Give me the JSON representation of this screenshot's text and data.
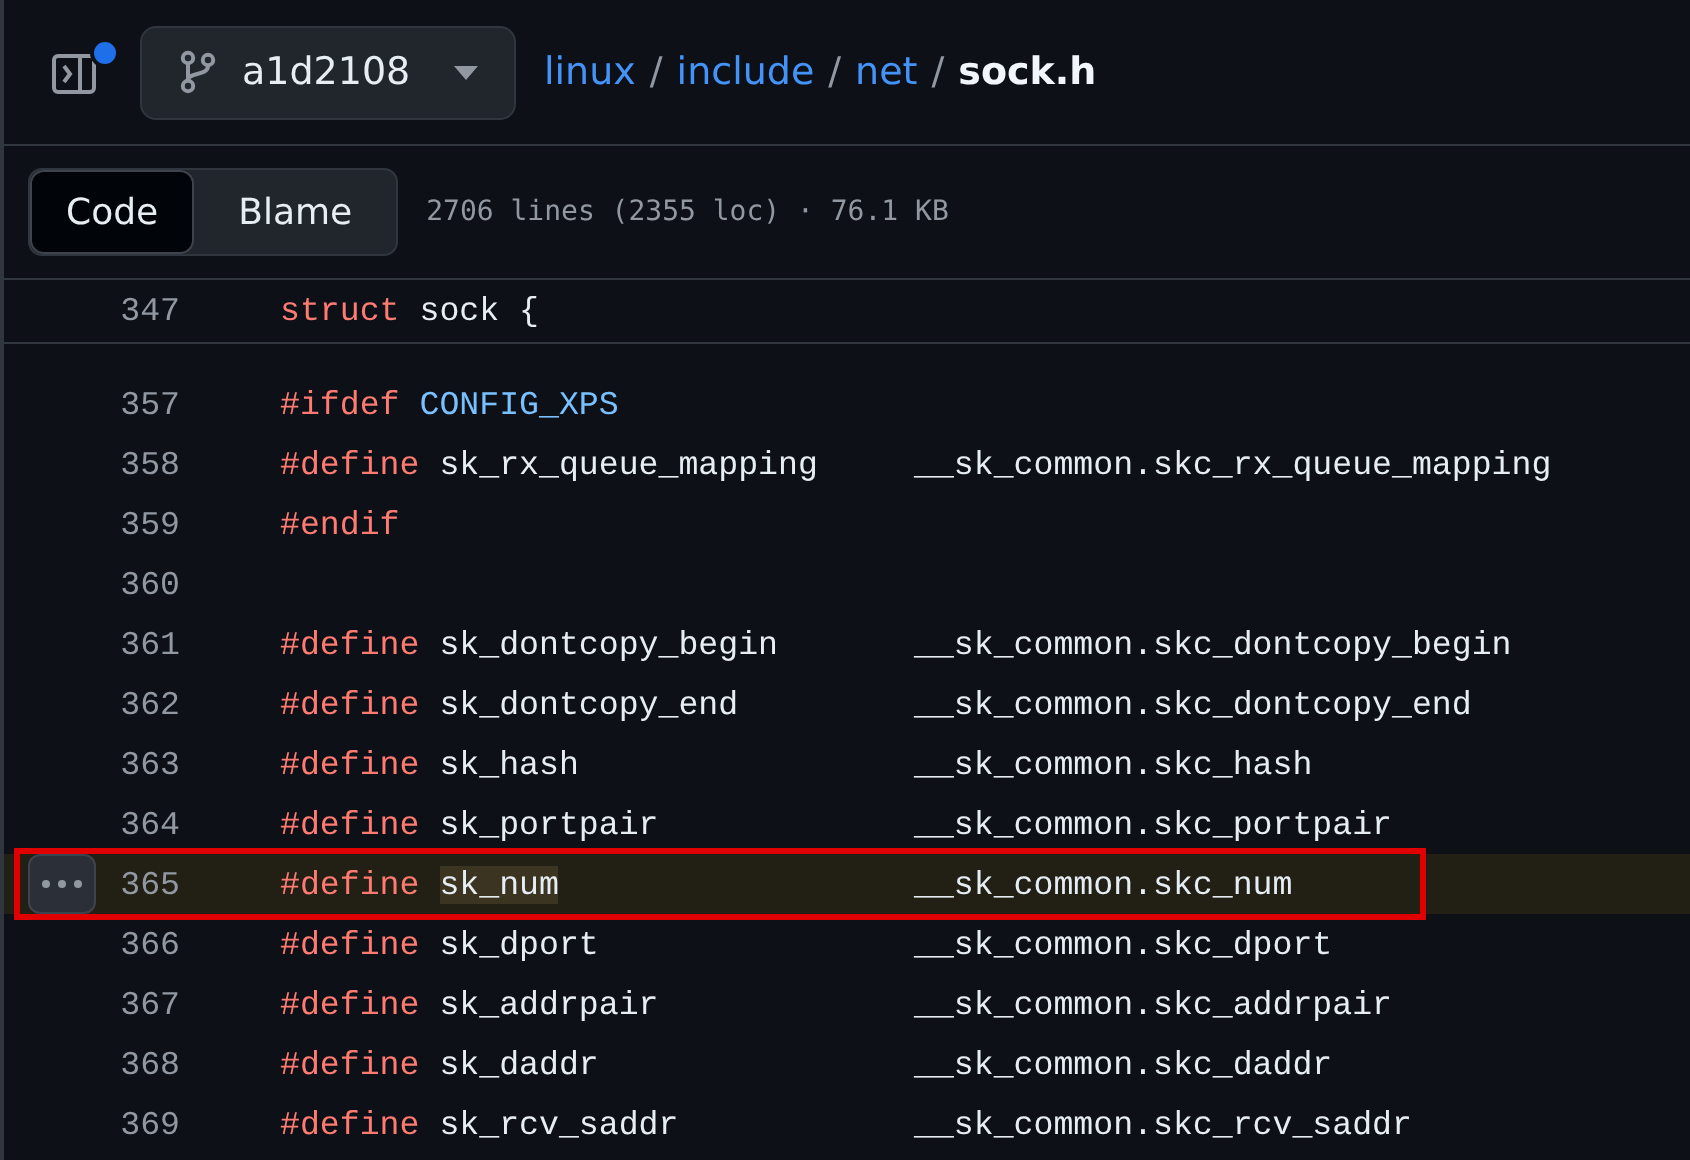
{
  "header": {
    "branch": "a1d2108",
    "notification_dot": true,
    "breadcrumb": [
      {
        "text": "linux",
        "kind": "link"
      },
      {
        "text": "include",
        "kind": "link"
      },
      {
        "text": "net",
        "kind": "link"
      },
      {
        "text": "sock.h",
        "kind": "current"
      }
    ],
    "separator": "/"
  },
  "view_tabs": [
    {
      "label": "Code",
      "selected": true
    },
    {
      "label": "Blame",
      "selected": false
    }
  ],
  "file_info": "2706 lines (2355 loc) · 76.1 KB",
  "sticky_line": {
    "number": "347",
    "tokens": [
      {
        "kind": "keyword",
        "text": "struct"
      },
      {
        "kind": "plain",
        "text": "sock {"
      }
    ]
  },
  "lines": [
    {
      "number": "357",
      "tokens": [
        {
          "kind": "keyword",
          "text": "#ifdef"
        },
        {
          "kind": "constant",
          "text": "CONFIG_XPS"
        }
      ],
      "selected": false,
      "annotated": false
    },
    {
      "number": "358",
      "tokens": [
        {
          "kind": "keyword",
          "text": "#define"
        },
        {
          "kind": "plain",
          "text": "sk_rx_queue_mapping"
        }
      ],
      "value": "__sk_common.skc_rx_queue_mapping",
      "selected": false,
      "annotated": false
    },
    {
      "number": "359",
      "tokens": [
        {
          "kind": "keyword",
          "text": "#endif"
        }
      ],
      "selected": false,
      "annotated": false
    },
    {
      "number": "360",
      "selected": false,
      "annotated": false
    },
    {
      "number": "361",
      "tokens": [
        {
          "kind": "keyword",
          "text": "#define"
        },
        {
          "kind": "plain",
          "text": "sk_dontcopy_begin"
        }
      ],
      "value": "__sk_common.skc_dontcopy_begin",
      "selected": false,
      "annotated": false
    },
    {
      "number": "362",
      "tokens": [
        {
          "kind": "keyword",
          "text": "#define"
        },
        {
          "kind": "plain",
          "text": "sk_dontcopy_end"
        }
      ],
      "value": "__sk_common.skc_dontcopy_end",
      "selected": false,
      "annotated": false
    },
    {
      "number": "363",
      "tokens": [
        {
          "kind": "keyword",
          "text": "#define"
        },
        {
          "kind": "plain",
          "text": "sk_hash"
        }
      ],
      "value": "__sk_common.skc_hash",
      "selected": false,
      "annotated": false
    },
    {
      "number": "364",
      "tokens": [
        {
          "kind": "keyword",
          "text": "#define"
        },
        {
          "kind": "plain",
          "text": "sk_portpair"
        }
      ],
      "value": "__sk_common.skc_portpair",
      "selected": false,
      "annotated": false
    },
    {
      "number": "365",
      "tokens": [
        {
          "kind": "keyword",
          "text": "#define"
        },
        {
          "kind": "match",
          "text": "sk_num"
        }
      ],
      "value": "__sk_common.skc_num",
      "selected": true,
      "annotated": true
    },
    {
      "number": "366",
      "tokens": [
        {
          "kind": "keyword",
          "text": "#define"
        },
        {
          "kind": "plain",
          "text": "sk_dport"
        }
      ],
      "value": "__sk_common.skc_dport",
      "selected": false,
      "annotated": false
    },
    {
      "number": "367",
      "tokens": [
        {
          "kind": "keyword",
          "text": "#define"
        },
        {
          "kind": "plain",
          "text": "sk_addrpair"
        }
      ],
      "value": "__sk_common.skc_addrpair",
      "selected": false,
      "annotated": false
    },
    {
      "number": "368",
      "tokens": [
        {
          "kind": "keyword",
          "text": "#define"
        },
        {
          "kind": "plain",
          "text": "sk_daddr"
        }
      ],
      "value": "__sk_common.skc_daddr",
      "selected": false,
      "annotated": false
    },
    {
      "number": "369",
      "tokens": [
        {
          "kind": "keyword",
          "text": "#define"
        },
        {
          "kind": "plain",
          "text": "sk_rcv_saddr"
        }
      ],
      "value": "__sk_common.skc_rcv_saddr",
      "selected": false,
      "annotated": false
    }
  ]
}
